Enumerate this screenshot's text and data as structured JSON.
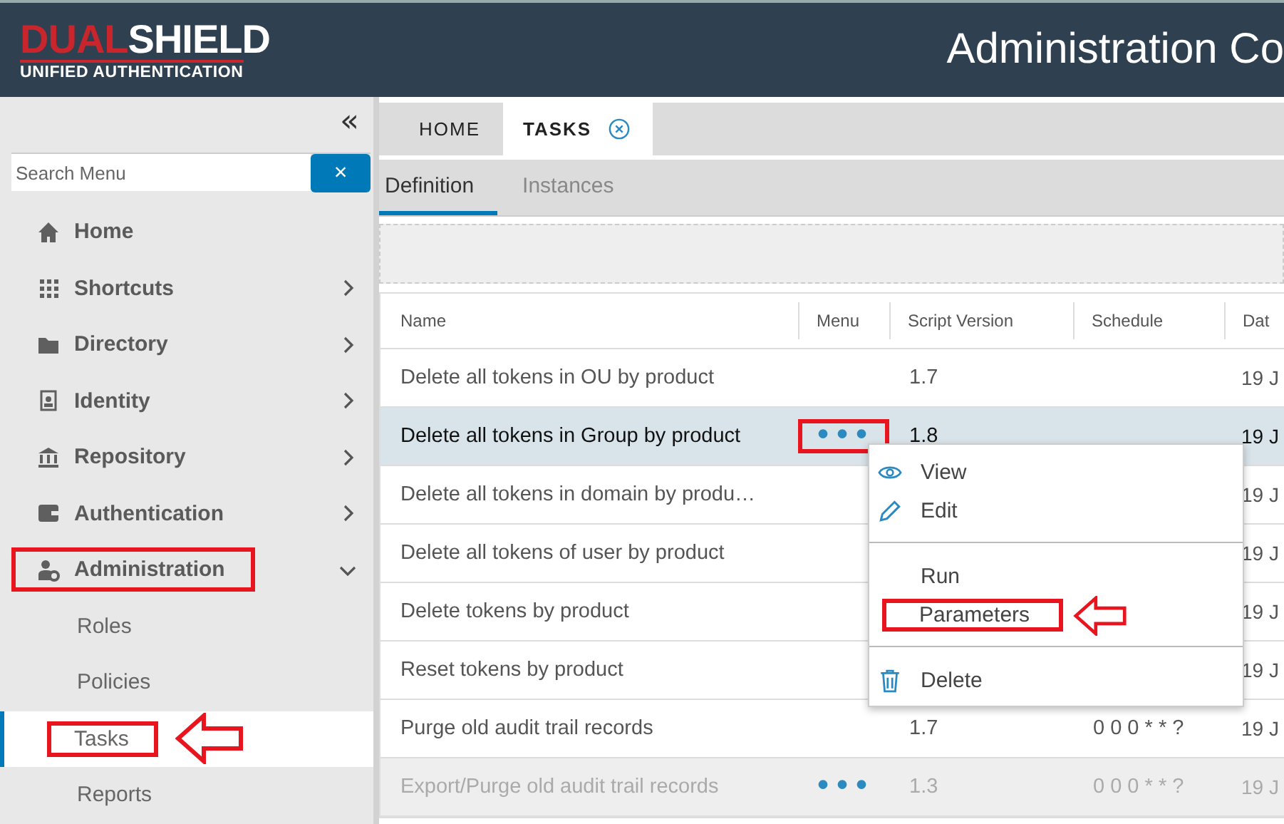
{
  "header": {
    "logo": {
      "red": "DUAL",
      "white": "SHIELD",
      "tagline": "UNIFIED AUTHENTICATION"
    },
    "title": "Administration Co"
  },
  "sidebar": {
    "collapse": "«",
    "search": {
      "placeholder": "Search Menu"
    },
    "clear": "×",
    "items": [
      {
        "label": "Home",
        "kind": "home"
      },
      {
        "label": "Shortcuts",
        "kind": "grid",
        "expanded": false
      },
      {
        "label": "Directory",
        "kind": "folder",
        "expanded": false
      },
      {
        "label": "Identity",
        "kind": "badge",
        "expanded": false
      },
      {
        "label": "Repository",
        "kind": "bank",
        "expanded": false
      },
      {
        "label": "Authentication",
        "kind": "wallet",
        "expanded": false
      },
      {
        "label": "Administration",
        "kind": "admin",
        "expanded": true,
        "highlight": true,
        "children": [
          {
            "label": "Roles",
            "selected": false
          },
          {
            "label": "Policies",
            "selected": false
          },
          {
            "label": "Tasks",
            "selected": true,
            "highlight": true,
            "pointer": true
          },
          {
            "label": "Reports",
            "selected": false
          }
        ]
      }
    ]
  },
  "tabs": [
    {
      "label": "HOME",
      "selected": false
    },
    {
      "label": "TASKS",
      "selected": true,
      "closable": true
    }
  ],
  "subtabs": [
    {
      "label": "Definition",
      "selected": true
    },
    {
      "label": "Instances",
      "selected": false
    }
  ],
  "table": {
    "columns": [
      "Name",
      "Menu",
      "Script Version",
      "Schedule",
      "Dat"
    ],
    "rows": [
      {
        "name": "Delete all tokens in OU by product",
        "version": "1.7",
        "date": "19 J",
        "selected": false,
        "disabled": false
      },
      {
        "name": "Delete all tokens in Group by product",
        "menu": "•••",
        "version": "1.8",
        "date": "19 J",
        "selected": true,
        "disabled": false,
        "highlight": true
      },
      {
        "name": "Delete all tokens in domain by produ…",
        "date": "19 J",
        "selected": false,
        "disabled": false
      },
      {
        "name": "Delete all tokens of user by product",
        "date": "19 J",
        "selected": false,
        "disabled": false
      },
      {
        "name": "Delete tokens by product",
        "date": "19 J",
        "selected": false,
        "disabled": false
      },
      {
        "name": "Reset tokens by product",
        "date": "19 J",
        "selected": false,
        "disabled": false
      },
      {
        "name": "Purge old audit trail records",
        "version": "1.7",
        "schedule": "0 0 0 * * ?",
        "date": "19 J",
        "selected": false,
        "disabled": false
      },
      {
        "name": "Export/Purge old audit trail records",
        "menu": "•••",
        "version": "1.3",
        "schedule": "0 0 0 * * ?",
        "date": "19 J",
        "selected": false,
        "disabled": true
      }
    ]
  },
  "context_menu": {
    "items": [
      {
        "kind": "view",
        "label": "View"
      },
      {
        "kind": "edit",
        "label": "Edit"
      },
      {
        "kind": "divider"
      },
      {
        "kind": "plain",
        "label": "Run"
      },
      {
        "kind": "plain",
        "label": "Parameters",
        "highlight": true,
        "pointer": true
      },
      {
        "kind": "divider"
      },
      {
        "kind": "delete",
        "label": "Delete"
      }
    ]
  }
}
